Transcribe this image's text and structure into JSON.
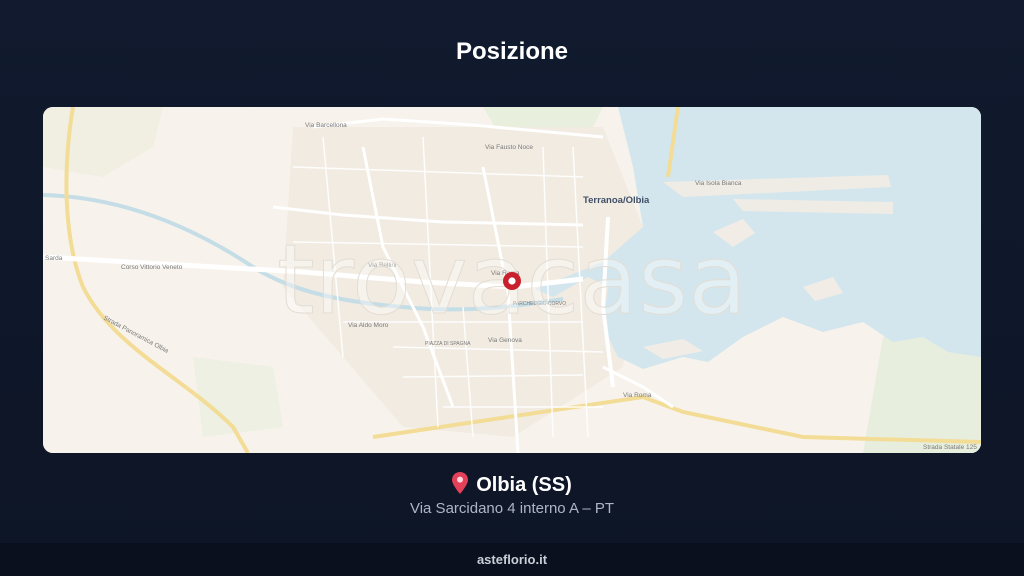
{
  "header": {
    "title": "Posizione"
  },
  "map": {
    "watermark": "trovacasa",
    "labels": {
      "city": "Terranoa/Olbia",
      "via_barcellona": "Via Barcellona",
      "via_fausto_noce": "Via Fausto Noce",
      "via_isola_bianca": "Via Isola Bianca",
      "corso_vittorio_veneto": "Corso Vittorio Veneto",
      "sarda": "Sarda",
      "strada_panoramica": "Strada Panoramica Olbia",
      "via_roma": "Via Roma",
      "via_genova": "Via Genova",
      "piazza_di_spagna": "PIAZZA DI SPAGNA",
      "parcheggio": "PARCHEGGIO CORVO",
      "strada_statale": "Strada Statale 125",
      "via_aldo_moro": "Via Aldo Moro",
      "via_bellini": "Via Bellini"
    },
    "marker_icon": "location-marker-icon"
  },
  "location": {
    "pin_icon": "map-pin-icon",
    "name": "Olbia (SS)",
    "address": "Via Sarcidano 4 interno A – PT"
  },
  "footer": {
    "site": "asteflorio.it"
  },
  "colors": {
    "background": "#111a2e",
    "land": "#f7f3ec",
    "water": "#d3e6ee",
    "marker": "#c8202c"
  }
}
